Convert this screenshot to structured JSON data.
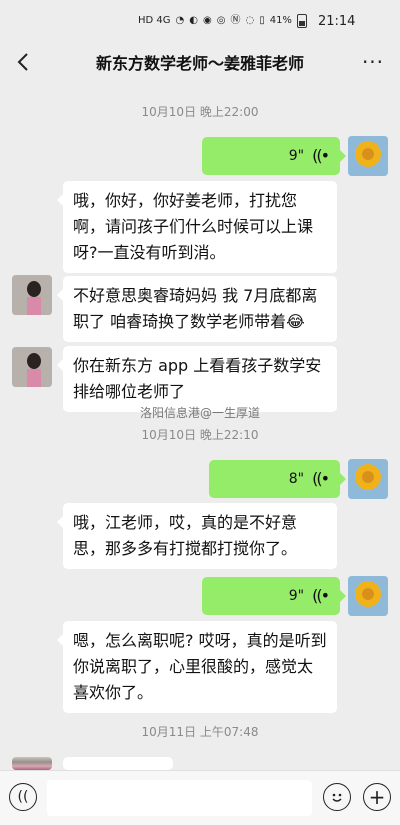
{
  "status": {
    "network": "HD 4G",
    "battery": "41%",
    "time": "21:14"
  },
  "header": {
    "title": "新东方数学老师～姜雅菲老师"
  },
  "messages": {
    "t1": "10月10日 晚上22:00",
    "v1_len": "9\"",
    "m1": "哦，你好，你好姜老师，打扰您啊，请问孩子们什么时候可以上课呀?一直没有听到消。",
    "m2": "不好意思奥睿琦妈妈 我 7月底都离职了 咱睿琦换了数学老师带着😂",
    "m3": "你在新东方 app 上看看孩子数学安排给哪位老师了",
    "watermark": "洛阳信息港@一生厚道",
    "t2": "10月10日 晚上22:10",
    "v2_len": "8\"",
    "m4": "哦，江老师，哎，真的是不好意思，那多多有打搅都打搅你了。",
    "v3_len": "9\"",
    "m5": "嗯，怎么离职呢? 哎呀，真的是听到你说离职了，心里很酸的，感觉太喜欢你了。",
    "t3": "10月11日 上午07:48"
  },
  "colors": {
    "background": "#ededed",
    "my_bubble": "#95ec69",
    "their_bubble": "#ffffff"
  },
  "icons": {
    "back": "chevron-left-icon",
    "more": "more-dots-icon",
    "voice_wave": "voice-wave-icon",
    "voice_input": "voice-input-icon",
    "emoji": "emoji-icon",
    "add": "plus-icon"
  }
}
